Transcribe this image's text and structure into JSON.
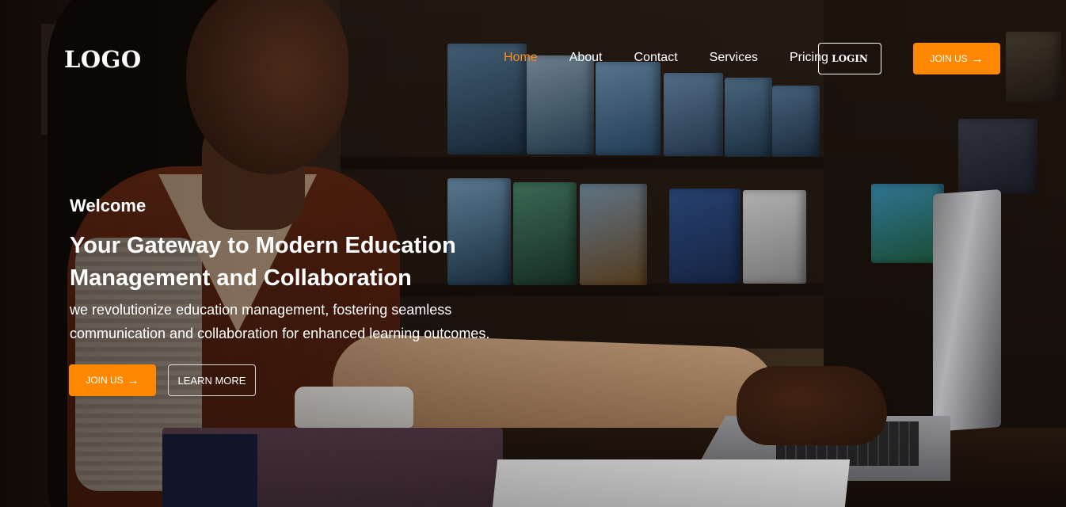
{
  "header": {
    "logo": "LOGO",
    "nav": [
      {
        "label": "Home",
        "active": true
      },
      {
        "label": "About",
        "active": false
      },
      {
        "label": "Contact",
        "active": false
      },
      {
        "label": "Services",
        "active": false
      },
      {
        "label": "Pricing",
        "active": false
      }
    ],
    "login_label": "LOGIN",
    "join_label": "JOIN US",
    "join_icon": "arrow-right-icon"
  },
  "hero": {
    "welcome": "Welcome",
    "headline": "Your Gateway to Modern Education Management and Collaboration",
    "subtext": "we revolutionize education management, fostering seamless communication and collaboration for enhanced learning outcomes.",
    "join_label": "JOIN US",
    "learn_more_label": "LEARN MORE"
  },
  "colors": {
    "accent": "#ff8800",
    "active_nav": "#ff8c1a",
    "text": "#ffffff"
  }
}
